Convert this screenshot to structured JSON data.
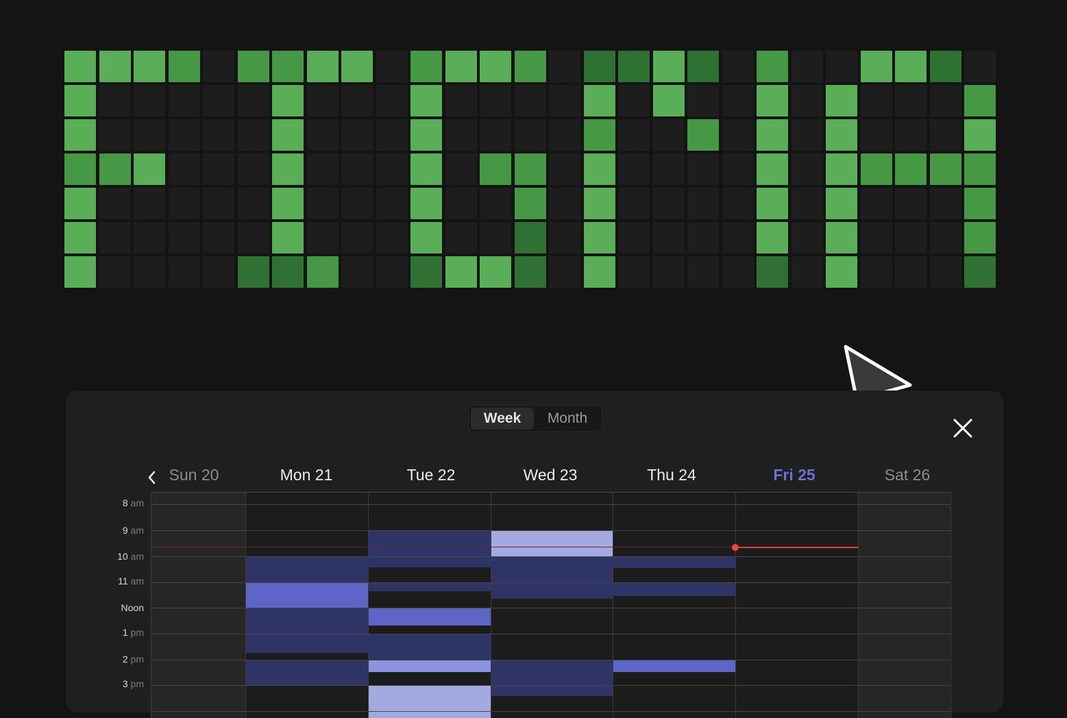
{
  "contribution_grid": {
    "rows": [
      [
        1,
        1,
        1,
        2,
        0,
        2,
        2,
        1,
        1,
        0,
        2,
        1,
        1,
        2,
        0,
        3,
        3,
        1,
        3,
        0,
        2,
        0,
        0,
        1,
        1,
        3,
        0
      ],
      [
        1,
        0,
        0,
        0,
        0,
        0,
        1,
        0,
        0,
        0,
        1,
        0,
        0,
        0,
        0,
        1,
        0,
        1,
        0,
        0,
        1,
        0,
        1,
        0,
        0,
        0,
        2
      ],
      [
        1,
        0,
        0,
        0,
        0,
        0,
        1,
        0,
        0,
        0,
        1,
        0,
        0,
        0,
        0,
        2,
        0,
        0,
        2,
        0,
        1,
        0,
        1,
        0,
        0,
        0,
        1
      ],
      [
        2,
        2,
        1,
        0,
        0,
        0,
        1,
        0,
        0,
        0,
        1,
        0,
        2,
        2,
        0,
        1,
        0,
        0,
        0,
        0,
        1,
        0,
        1,
        2,
        2,
        2,
        2
      ],
      [
        1,
        0,
        0,
        0,
        0,
        0,
        1,
        0,
        0,
        0,
        1,
        0,
        0,
        2,
        0,
        1,
        0,
        0,
        0,
        0,
        1,
        0,
        1,
        0,
        0,
        0,
        2
      ],
      [
        1,
        0,
        0,
        0,
        0,
        0,
        1,
        0,
        0,
        0,
        1,
        0,
        0,
        3,
        0,
        1,
        0,
        0,
        0,
        0,
        1,
        0,
        1,
        0,
        0,
        0,
        2
      ],
      [
        1,
        0,
        0,
        0,
        0,
        3,
        3,
        2,
        0,
        0,
        3,
        1,
        1,
        3,
        0,
        1,
        0,
        0,
        0,
        0,
        3,
        0,
        1,
        0,
        0,
        0,
        3
      ]
    ]
  },
  "calendar": {
    "view_toggle": {
      "week_label": "Week",
      "month_label": "Month",
      "selected": "Week"
    },
    "days": [
      {
        "label": "Sun 20",
        "state": "muted"
      },
      {
        "label": "Mon 21",
        "state": "normal"
      },
      {
        "label": "Tue 22",
        "state": "normal"
      },
      {
        "label": "Wed 23",
        "state": "normal"
      },
      {
        "label": "Thu 24",
        "state": "normal"
      },
      {
        "label": "Fri 25",
        "state": "today"
      },
      {
        "label": "Sat 26",
        "state": "muted"
      }
    ],
    "hours": [
      {
        "num": "8",
        "suffix": "am"
      },
      {
        "num": "9",
        "suffix": "am"
      },
      {
        "num": "10",
        "suffix": "am"
      },
      {
        "num": "11",
        "suffix": "am"
      },
      {
        "num": "Noon",
        "suffix": ""
      },
      {
        "num": "1",
        "suffix": "pm"
      },
      {
        "num": "2",
        "suffix": "pm"
      },
      {
        "num": "3",
        "suffix": "pm"
      }
    ],
    "current_time_indicator": {
      "day": "Fri 25"
    },
    "colors": {
      "today": "#6a71cf",
      "event_dark": "#2e3566",
      "event_mid": "#5d66c4",
      "event_light": "#8c94dd",
      "event_pale": "#a2aadf",
      "now_line": "#e0403a",
      "grid_high": "#5aae58",
      "grid_mid": "#469845",
      "grid_low": "#2f7133",
      "grid_empty": "#1d1d1d"
    }
  }
}
